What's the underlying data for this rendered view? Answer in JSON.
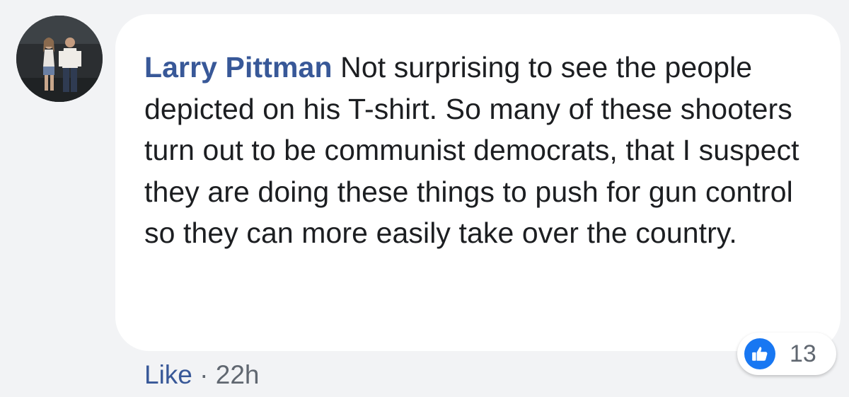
{
  "comment": {
    "author": "Larry Pittman",
    "text": "Not surprising to see the people depicted on his T-shirt. So many of these shooters turn out to be communist democrats, that I suspect they are doing these things to push for gun control so they can more easily take over the country.",
    "actions": {
      "like_label": "Like",
      "separator": "·",
      "timestamp": "22h"
    },
    "reactions": {
      "icon": "thumbs-up-icon",
      "count": "13"
    }
  },
  "colors": {
    "author_link": "#385898",
    "like_badge": "#1877f2",
    "bubble": "#ffffff",
    "page": "#f2f3f5"
  }
}
